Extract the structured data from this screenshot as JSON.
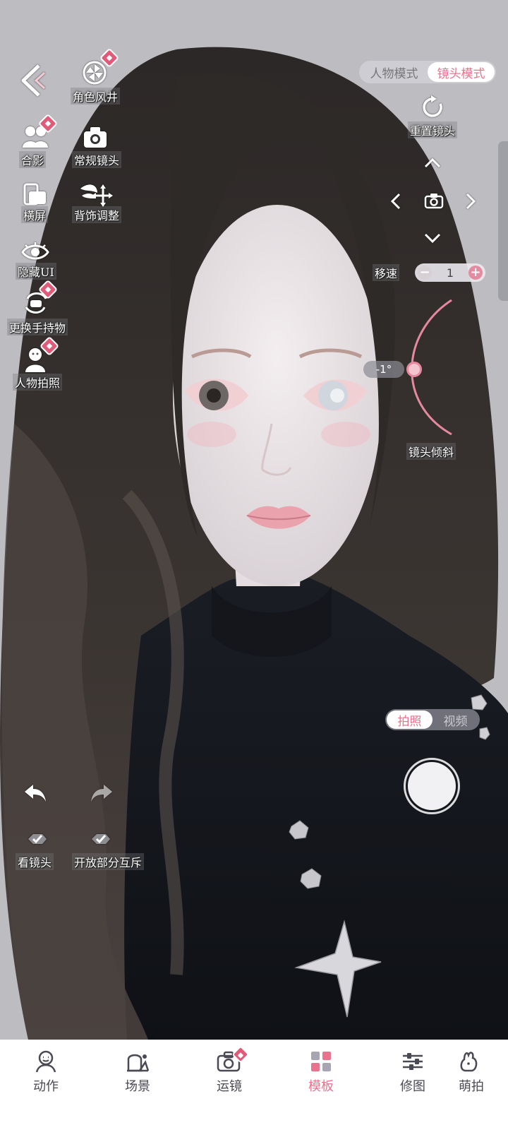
{
  "mode_toggle": {
    "character_mode": "人物模式",
    "camera_mode": "镜头模式",
    "active": "camera_mode"
  },
  "left_tools": [
    {
      "label": "角色风井",
      "icon": "pinwheel-icon",
      "badge": true
    },
    {
      "label": "合影",
      "icon": "group-photo-icon",
      "badge": true
    },
    {
      "label": "常规镜头",
      "icon": "camera-icon",
      "badge": false
    },
    {
      "label": "横屏",
      "icon": "landscape-icon",
      "badge": false
    },
    {
      "label": "背饰调整",
      "icon": "wing-adjust-icon",
      "badge": false
    },
    {
      "label": "隐藏UI",
      "icon": "eye-icon",
      "badge": false
    },
    {
      "label": "更换手持物",
      "icon": "handheld-swap-icon",
      "badge": true
    },
    {
      "label": "人物拍照",
      "icon": "person-photo-icon",
      "badge": true
    }
  ],
  "camera_controls": {
    "reset_label": "重置镜头",
    "speed_label": "移速",
    "speed_value": "1",
    "tilt_label": "镜头倾斜",
    "tilt_value": "-1°"
  },
  "history": {
    "look_at_camera": "看镜头",
    "open_interaction": "开放部分互斥"
  },
  "capture": {
    "photo": "拍照",
    "video": "视频",
    "active": "photo"
  },
  "bottom_nav": [
    {
      "label": "动作",
      "icon": "pose-icon",
      "active": false
    },
    {
      "label": "场景",
      "icon": "scene-icon",
      "active": false
    },
    {
      "label": "运镜",
      "icon": "camera-move-icon",
      "active": false,
      "badge": true
    },
    {
      "label": "模板",
      "icon": "template-icon",
      "active": true
    },
    {
      "label": "修图",
      "icon": "adjust-icon",
      "active": false
    },
    {
      "label": "萌拍",
      "icon": "cute-icon",
      "active": false
    }
  ],
  "colors": {
    "accent": "#e8738c",
    "badge": "#e05b7a",
    "background": "#bdbcc1"
  }
}
